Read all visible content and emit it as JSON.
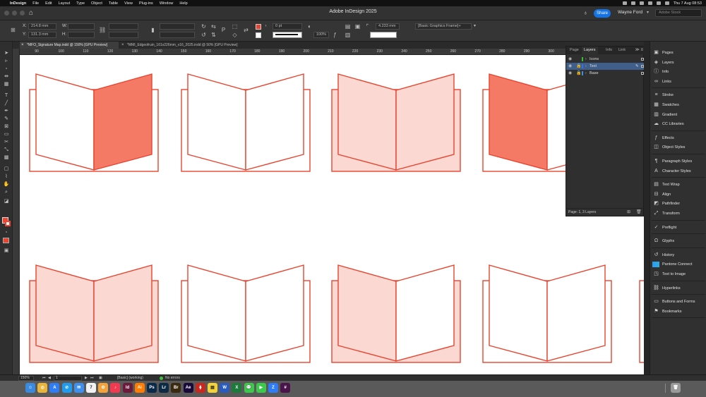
{
  "menubar": {
    "app_name": "InDesign",
    "items": [
      "File",
      "Edit",
      "Layout",
      "Type",
      "Object",
      "Table",
      "View",
      "Plug-ins",
      "Window",
      "Help"
    ],
    "clock": "Thu 7 Aug  08:53"
  },
  "titlebar": {
    "title": "Adobe InDesign 2025",
    "share_label": "Share",
    "user_name": "Wayne Ford",
    "stock_placeholder": "Adobe Stock"
  },
  "control": {
    "x_label": "X:",
    "x_value": "214.8 mm",
    "y_label": "Y:",
    "y_value": "131.3 mm",
    "w_label": "W:",
    "h_label": "H:",
    "stroke_weight": "0 pt",
    "scale_value": "100%",
    "corner_value": "4.233 mm",
    "object_style": "[Basic Graphics Frame]+",
    "fill_color": "#e8442f"
  },
  "tabs": [
    {
      "label": "*MFO_Signature Map.indd @ 150% [GPU Preview]",
      "active": true
    },
    {
      "label": "*MMI_Edgeofruin_161x226mm_v16_2025.indd @ 50% [GPU Preview]",
      "active": false
    }
  ],
  "ruler": {
    "ticks": [
      "90",
      "100",
      "110",
      "120",
      "130",
      "140",
      "150",
      "160",
      "170",
      "180",
      "190",
      "200",
      "210",
      "220",
      "230",
      "240",
      "250",
      "260",
      "270",
      "280",
      "290",
      "300",
      "310"
    ]
  },
  "layers_panel": {
    "tabs": [
      "Page",
      "Layers",
      "Info",
      "Link"
    ],
    "active_tab": "Layers",
    "layers": [
      {
        "name": "Icons",
        "color": "#2fbf2f",
        "selected": false,
        "locked": false
      },
      {
        "name": "Text",
        "color": "#3a6fe0",
        "selected": true,
        "locked": true
      },
      {
        "name": "Base",
        "color": "#3a8fe0",
        "selected": false,
        "locked": true
      }
    ],
    "footer": "Page: 1, 3 Layers"
  },
  "right_dock": {
    "groups": [
      [
        {
          "icon": "pages-icon",
          "label": "Pages"
        },
        {
          "icon": "layers-icon",
          "label": "Layers"
        },
        {
          "icon": "info-icon",
          "label": "Info"
        },
        {
          "icon": "links-icon",
          "label": "Links"
        }
      ],
      [
        {
          "icon": "stroke-icon",
          "label": "Stroke"
        },
        {
          "icon": "swatches-icon",
          "label": "Swatches"
        },
        {
          "icon": "gradient-icon",
          "label": "Gradient"
        },
        {
          "icon": "cc-libraries-icon",
          "label": "CC Libraries"
        }
      ],
      [
        {
          "icon": "effects-icon",
          "label": "Effects"
        },
        {
          "icon": "object-styles-icon",
          "label": "Object Styles"
        }
      ],
      [
        {
          "icon": "paragraph-styles-icon",
          "label": "Paragraph Styles"
        },
        {
          "icon": "character-styles-icon",
          "label": "Character Styles"
        }
      ],
      [
        {
          "icon": "text-wrap-icon",
          "label": "Text Wrap"
        },
        {
          "icon": "align-icon",
          "label": "Align"
        },
        {
          "icon": "pathfinder-icon",
          "label": "Pathfinder"
        },
        {
          "icon": "transform-icon",
          "label": "Transform"
        }
      ],
      [
        {
          "icon": "preflight-icon",
          "label": "Preflight"
        }
      ],
      [
        {
          "icon": "glyphs-icon",
          "label": "Glyphs"
        }
      ],
      [
        {
          "icon": "history-icon",
          "label": "History"
        },
        {
          "icon": "pantone-icon",
          "label": "Pantone Connect"
        },
        {
          "icon": "text-to-image-icon",
          "label": "Text to Image"
        }
      ],
      [
        {
          "icon": "hyperlinks-icon",
          "label": "Hyperlinks"
        }
      ],
      [
        {
          "icon": "buttons-forms-icon",
          "label": "Buttons and Forms"
        },
        {
          "icon": "bookmarks-icon",
          "label": "Bookmarks"
        }
      ]
    ]
  },
  "statusbar": {
    "zoom": "150%",
    "page": "1",
    "style": "[Basic] (working)",
    "errors": "No errors"
  },
  "canvas": {
    "accent": "#e8442f",
    "light_fill": "#fcd8d2",
    "dark_fill": "#f57a66",
    "booklets_row1": [
      {
        "left": "none",
        "right": "dark"
      },
      {
        "left": "none",
        "right": "none"
      },
      {
        "left": "light",
        "right": "light"
      },
      {
        "left": "dark",
        "right": "none"
      }
    ],
    "booklets_row2": [
      {
        "left": "light",
        "right": "light"
      },
      {
        "left": "none",
        "right": "none"
      },
      {
        "left": "light",
        "right": "none"
      },
      {
        "left": "none",
        "right": "none"
      }
    ]
  },
  "dock_apps": [
    "Finder",
    "Chrome",
    "App Store",
    "Safari",
    "Mail",
    "Calendar",
    "Photos",
    "Music",
    "Id",
    "Ai",
    "Ps",
    "Lr",
    "Br",
    "Ae",
    "Acrobat",
    "Notes",
    "Word",
    "Excel",
    "Messages",
    "FaceTime",
    "Zoom",
    "Slack",
    "Trash"
  ]
}
